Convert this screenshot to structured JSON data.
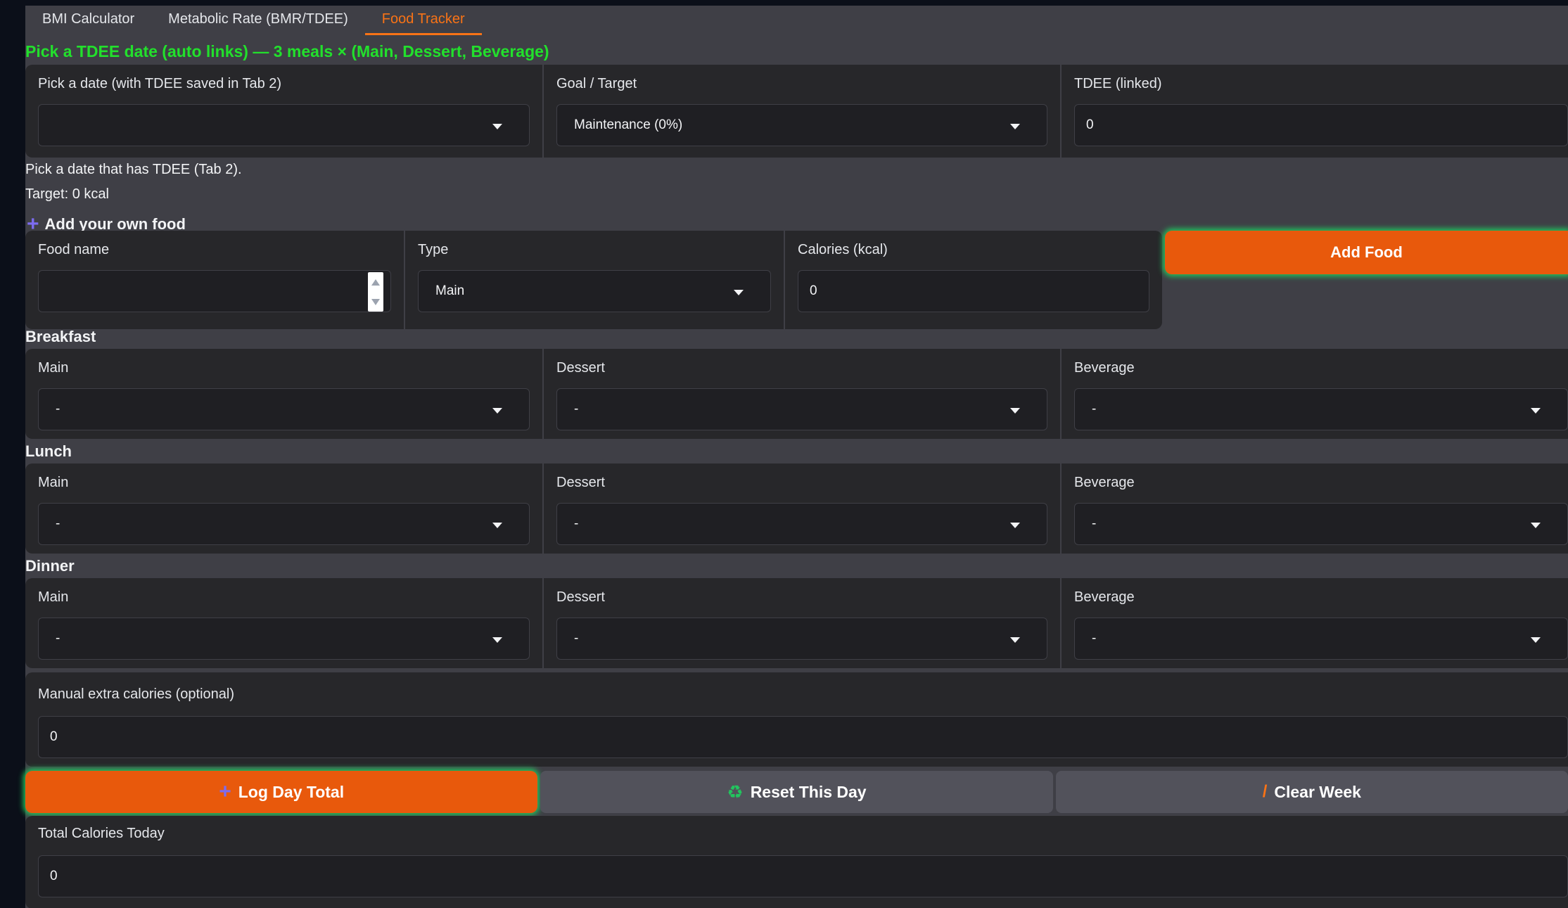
{
  "tabs": [
    {
      "label": "BMI Calculator",
      "active": false
    },
    {
      "label": "Metabolic Rate (BMR/TDEE)",
      "active": false
    },
    {
      "label": "Food Tracker",
      "active": true
    }
  ],
  "headline": "Pick a TDEE date (auto links) — 3 meals × (Main, Dessert, Beverage)",
  "date_row": {
    "date_label": "Pick a date (with TDEE saved in Tab 2)",
    "date_value": "",
    "goal_label": "Goal / Target",
    "goal_value": "Maintenance (0%)",
    "tdee_label": "TDEE (linked)",
    "tdee_value": "0"
  },
  "hint": "Pick a date that has TDEE (Tab 2).",
  "target": "Target: 0 kcal",
  "add_own": {
    "title": "Add your own food",
    "food_name_label": "Food name",
    "food_name_value": "",
    "type_label": "Type",
    "type_value": "Main",
    "calories_label": "Calories (kcal)",
    "calories_value": "0",
    "add_button": "Add Food"
  },
  "meals": [
    {
      "title": "Breakfast",
      "main_label": "Main",
      "main_value": "-",
      "dessert_label": "Dessert",
      "dessert_value": "-",
      "beverage_label": "Beverage",
      "beverage_value": "-"
    },
    {
      "title": "Lunch",
      "main_label": "Main",
      "main_value": "-",
      "dessert_label": "Dessert",
      "dessert_value": "-",
      "beverage_label": "Beverage",
      "beverage_value": "-"
    },
    {
      "title": "Dinner",
      "main_label": "Main",
      "main_value": "-",
      "dessert_label": "Dessert",
      "dessert_value": "-",
      "beverage_label": "Beverage",
      "beverage_value": "-"
    }
  ],
  "manual": {
    "label": "Manual extra calories (optional)",
    "value": "0"
  },
  "buttons": {
    "log": "Log Day Total",
    "reset": "Reset This Day",
    "clear": "Clear Week"
  },
  "total": {
    "label": "Total Calories Today",
    "value": "0"
  },
  "icons": {
    "plus": "plus-icon",
    "recycle": "recycle-icon",
    "broom": "broom-icon",
    "caret": "chevron-down-icon"
  },
  "colors": {
    "accent": "#f97316",
    "button": "#e8590c",
    "headline": "#22e02c",
    "glow": "#22c55e",
    "panel": "#27272a",
    "background": "#3f3f46"
  }
}
